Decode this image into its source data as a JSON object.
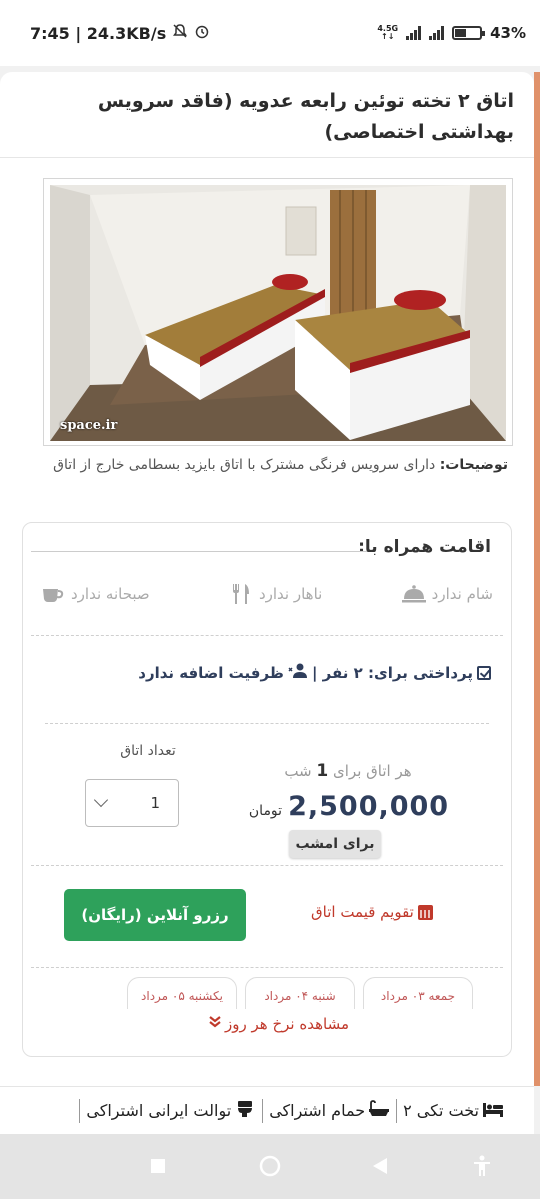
{
  "status_bar": {
    "time_speed": "7:45 | 24.3KB/s",
    "network": "4.5G",
    "battery": "43%"
  },
  "room": {
    "title": "اتاق ۲ تخته توئین رابعه عدویه (فاقد سرویس بهداشتی اختصاصی)",
    "watermark": "space.ir",
    "description_label": "توضیحات:",
    "description_text": "دارای سرویس فرنگی مشترک با اتاق بایزید بسطامی خارج از اتاق"
  },
  "booking": {
    "stay_with_label": "اقامت همراه با:",
    "meals": [
      {
        "icon": "coffee-cup-icon",
        "label": "صبحانه ندارد"
      },
      {
        "icon": "fork-knife-icon",
        "label": "ناهار ندارد"
      },
      {
        "icon": "cloche-icon",
        "label": "شام ندارد"
      }
    ],
    "payment_label": "پرداختی برای: ۲ نفر |",
    "extra_capacity": "ظرفیت اضافه ندارد",
    "per_room_label": "هر اتاق برای",
    "nights": "1",
    "night_word": "شب",
    "price": "2,500,000",
    "currency": "تومان",
    "tonight_badge": "برای امشب",
    "room_count_label": "تعداد اتاق",
    "room_count_value": "1",
    "book_button": "رزرو آنلاین (رایگان)",
    "price_calendar_link": "تقویم قیمت اتاق",
    "day_tabs": [
      "جمعه ۰۳ مرداد",
      "شنبه ۰۴ مرداد",
      "یکشنبه ۰۵ مرداد"
    ],
    "daily_rates_link": "مشاهده نرخ هر روز"
  },
  "amenities": [
    {
      "icon": "bed-icon",
      "label": "۲ تخت تکی"
    },
    {
      "icon": "bathtub-icon",
      "label": "حمام اشتراکی"
    },
    {
      "icon": "toilet-icon",
      "label": "توالت ایرانی اشتراکی"
    }
  ],
  "colors": {
    "accent": "#e0916a",
    "primary_text": "#2f3e5c",
    "book_button": "#2ea15b",
    "link_red": "#c0392b"
  }
}
